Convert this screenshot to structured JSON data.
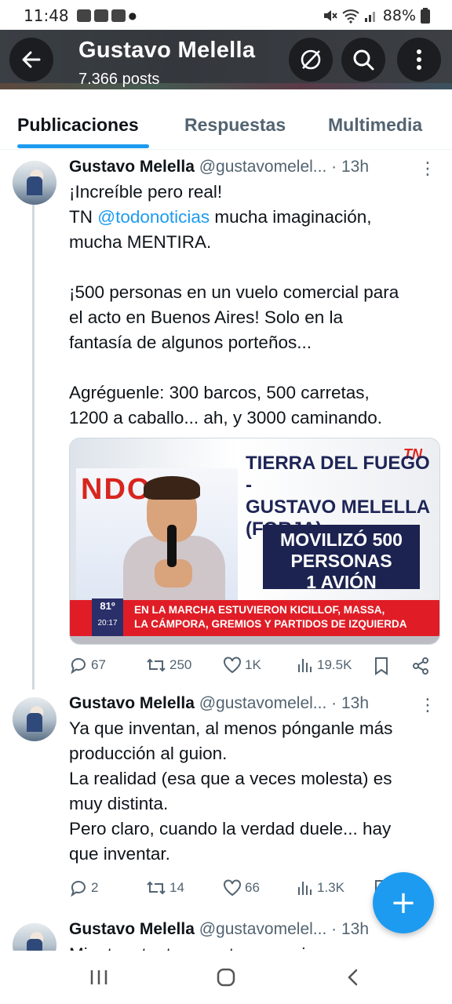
{
  "status_bar": {
    "time": "11:48",
    "battery": "88%"
  },
  "header": {
    "title": "Gustavo Melella",
    "subtitle": "7.366 posts"
  },
  "tabs": [
    {
      "label": "Publicaciones",
      "active": true
    },
    {
      "label": "Respuestas",
      "active": false
    },
    {
      "label": "Multimedia",
      "active": false
    }
  ],
  "tweets": [
    {
      "name": "Gustavo Melella",
      "handle": "@gustavomelel...",
      "time": "· 13h",
      "lines": [
        "¡Increíble pero real!",
        "TN ",
        "@todonoticias",
        " mucha imaginación,",
        "mucha MENTIRA.",
        "¡500 personas en un vuelo comercial para",
        "el acto en Buenos Aires! Solo en la",
        "fantasía de algunos porteños...",
        "Agréguenle: 300 barcos, 500 carretas,",
        "1200 a caballo... ah, y 3000 caminando."
      ],
      "media": {
        "left_text": "NDO",
        "title_line1": "TIERRA DEL FUEGO -",
        "title_line2": "GUSTAVO MELELLA",
        "title_line3": "(FORJA)",
        "box_line1": "MOVILIZÓ 500",
        "box_line2": "PERSONAS",
        "box_line3": "1 AVIÓN",
        "ticker_line1": "EN LA MARCHA ESTUVIERON KICILLOF, MASSA,",
        "ticker_line2": "LA CÁMPORA, GREMIOS Y PARTIDOS DE IZQUIERDA",
        "ticker_logo_num": "81º",
        "ticker_logo_time": "20:17",
        "brand": "TN"
      },
      "replies": "67",
      "reposts": "250",
      "likes": "1K",
      "views": "19.5K"
    },
    {
      "name": "Gustavo Melella",
      "handle": "@gustavomelel...",
      "time": "· 13h",
      "lines": [
        "Ya que inventan, al menos pónganle más",
        "producción al guion.",
        "La realidad (esa que a veces molesta) es",
        "muy distinta.",
        "Pero claro, cuando la verdad duele... hay",
        "que inventar."
      ],
      "replies": "2",
      "reposts": "14",
      "likes": "66",
      "views": "1.3K"
    },
    {
      "name": "Gustavo Melella",
      "handle": "@gustavomelel...",
      "time": "· 13h",
      "lines": [
        "Mientras tanto, nosotros seguimos"
      ]
    }
  ],
  "fab": {
    "label": "+"
  },
  "colors": {
    "accent": "#1d9bf0",
    "header_bg": "#3a3f44",
    "text": "#0f1419",
    "muted": "#536471"
  }
}
